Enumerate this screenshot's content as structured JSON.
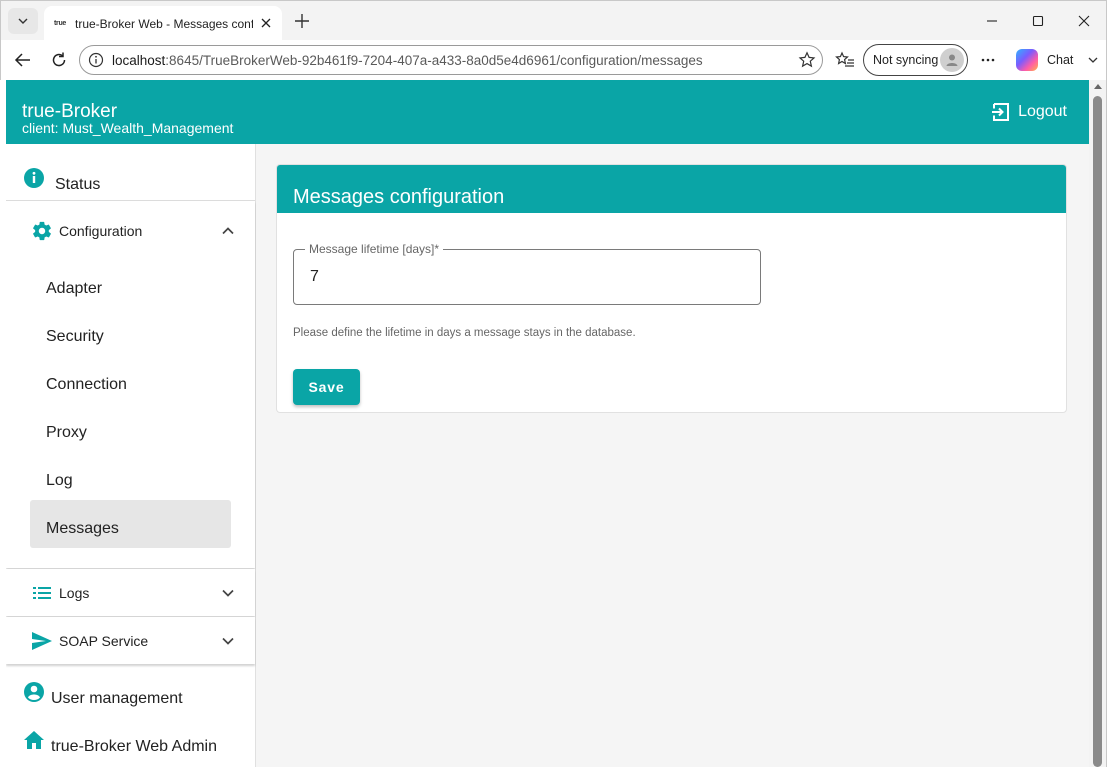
{
  "browser": {
    "tab_title": "true-Broker Web - Messages confi",
    "favicon_text": "true",
    "address": {
      "url_host": "localhost",
      "url_rest": ":8645/TrueBrokerWeb-92b461f9-7204-407a-a433-8a0d5e4d6961/configuration/messages"
    },
    "sync_label": "Not syncing",
    "chat_label": "Chat"
  },
  "header": {
    "brand": "true-Broker",
    "client": "client: Must_Wealth_Management",
    "logout_label": "Logout",
    "color": "#0aa5a6"
  },
  "sidebar": {
    "status": "Status",
    "configuration": {
      "label": "Configuration",
      "items": [
        "Adapter",
        "Security",
        "Connection",
        "Proxy",
        "Log",
        "Messages"
      ],
      "active": "Messages"
    },
    "logs": "Logs",
    "soap_service": "SOAP Service",
    "user_management": "User management",
    "web_admin": "true-Broker Web Admin"
  },
  "main": {
    "card_title": "Messages configuration",
    "field": {
      "label": "Message lifetime [days]*",
      "value": "7"
    },
    "hint": "Please define the lifetime in days a message stays in the database.",
    "save_label": "Save"
  }
}
